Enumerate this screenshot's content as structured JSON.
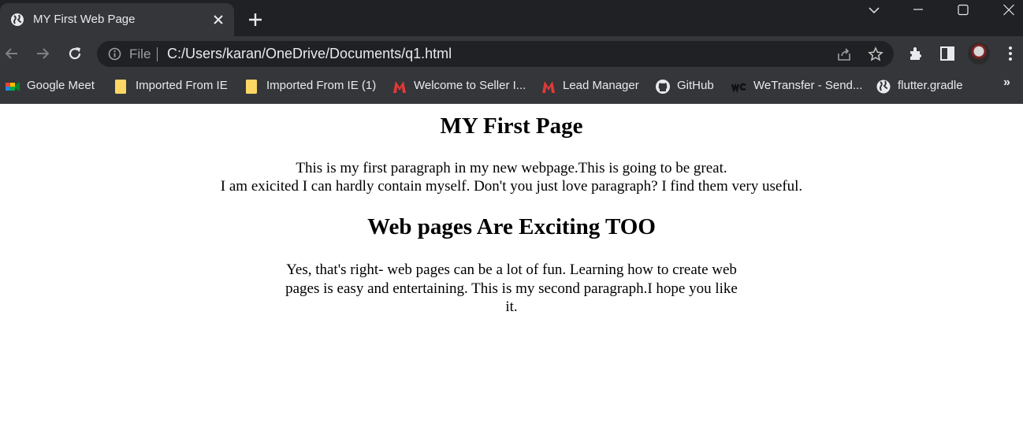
{
  "browser": {
    "tab": {
      "title": "MY First Web Page"
    },
    "omnibox": {
      "scheme_label": "File",
      "url": "C:/Users/karan/OneDrive/Documents/q1.html"
    },
    "bookmarks": [
      {
        "label": "Google Meet",
        "icon": "google-meet-icon"
      },
      {
        "label": "Imported From IE",
        "icon": "folder-icon"
      },
      {
        "label": "Imported From IE (1)",
        "icon": "folder-icon"
      },
      {
        "label": "Welcome to Seller I...",
        "icon": "m-logo-icon"
      },
      {
        "label": "Lead Manager",
        "icon": "m-logo-icon"
      },
      {
        "label": "GitHub",
        "icon": "github-icon"
      },
      {
        "label": "WeTransfer - Send...",
        "icon": "wetransfer-icon"
      },
      {
        "label": "flutter.gradle",
        "icon": "globe-icon"
      }
    ],
    "bookmarks_overflow": "»"
  },
  "page": {
    "heading1": "MY First Page",
    "paragraph1_line1": "This is my first paragraph in my new webpage.This is going to be great.",
    "paragraph1_line2": "I am exicited I can hardly contain myself. Don't you just love paragraph? I find them very useful.",
    "heading2": "Web pages Are Exciting TOO",
    "paragraph2": "Yes, that's right- web pages can be a lot of fun. Learning how to create web pages is easy and entertaining. This is my second paragraph.I hope you like it."
  },
  "colors": {
    "tabstrip_bg": "#202124",
    "toolbar_bg": "#35363a",
    "omnibox_bg": "#202124",
    "text_light": "#e8eaed",
    "page_bg": "#ffffff"
  }
}
